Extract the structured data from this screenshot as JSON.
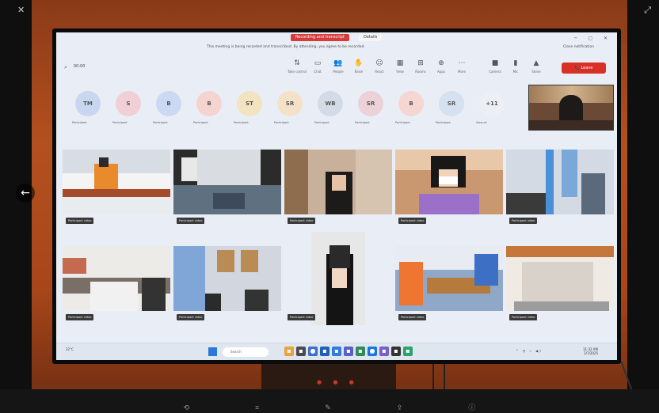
{
  "recording": {
    "banner": "Recording and transcript",
    "info": "Details"
  },
  "notice": "This meeting is being recorded and transcribed. By attending, you agree to be recorded.",
  "notice_right": "Close notification",
  "toolbar": {
    "title": "00:00",
    "buttons": [
      {
        "label": "Take control",
        "icon": "take-control-icon",
        "glyph": "⇅"
      },
      {
        "label": "Chat",
        "icon": "chat-icon",
        "glyph": "▭"
      },
      {
        "label": "People",
        "icon": "people-icon",
        "glyph": "👥"
      },
      {
        "label": "Raise",
        "icon": "hand-icon",
        "glyph": "✋"
      },
      {
        "label": "React",
        "icon": "react-icon",
        "glyph": "☺"
      },
      {
        "label": "View",
        "icon": "view-icon",
        "glyph": "▦"
      },
      {
        "label": "Rooms",
        "icon": "rooms-icon",
        "glyph": "⊞"
      },
      {
        "label": "Apps",
        "icon": "apps-icon",
        "glyph": "⊕"
      },
      {
        "label": "More",
        "icon": "more-icon",
        "glyph": "⋯"
      },
      {
        "label": "Camera",
        "icon": "camera-icon",
        "glyph": "■"
      },
      {
        "label": "Mic",
        "icon": "mic-icon",
        "glyph": "▮"
      },
      {
        "label": "Share",
        "icon": "share-icon",
        "glyph": "▲"
      }
    ],
    "leave_label": "Leave"
  },
  "avatars": [
    {
      "initials": "TM",
      "label": "Participant",
      "color": "#c9d6f0"
    },
    {
      "initials": "S",
      "label": "Participant",
      "color": "#f0d0d6"
    },
    {
      "initials": "B",
      "label": "Participant",
      "color": "#cbdaf2"
    },
    {
      "initials": "B",
      "label": "Participant",
      "color": "#f5d3cf"
    },
    {
      "initials": "ST",
      "label": "Participant",
      "color": "#f3e3c0"
    },
    {
      "initials": "SR",
      "label": "Participant",
      "color": "#f5e1c7"
    },
    {
      "initials": "WB",
      "label": "Participant",
      "color": "#d4dbe6"
    },
    {
      "initials": "SR",
      "label": "Participant",
      "color": "#ecd1d8"
    },
    {
      "initials": "B",
      "label": "Participant",
      "color": "#f5d6d2"
    },
    {
      "initials": "SR",
      "label": "Participant",
      "color": "#d5e0f0"
    },
    {
      "initials": "+11",
      "label": "View all",
      "color": "#eceff4"
    }
  ],
  "tiles": [
    {
      "name": "Participant video",
      "scene": "monk"
    },
    {
      "name": "Participant video",
      "scene": "office"
    },
    {
      "name": "Participant video",
      "scene": "woman1"
    },
    {
      "name": "Participant video",
      "scene": "woman2"
    },
    {
      "name": "Participant video",
      "scene": "office2"
    },
    {
      "name": "Participant video",
      "scene": "room1"
    },
    {
      "name": "Participant video",
      "scene": "portrait"
    },
    {
      "name": "Participant video",
      "scene": "woman3"
    },
    {
      "name": "Participant video",
      "scene": "meeting"
    },
    {
      "name": "Participant video",
      "scene": "empty"
    }
  ],
  "taskbar": {
    "weather": "32°C",
    "search_placeholder": "Search",
    "clock_time": "11:32 AM",
    "clock_date": "1/7/2025"
  }
}
